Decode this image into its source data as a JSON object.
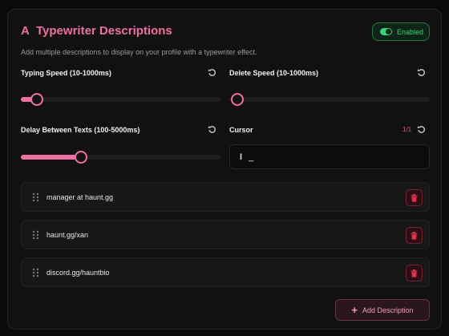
{
  "header": {
    "title": "Typewriter Descriptions",
    "subtitle": "Add multiple descriptions to display on your profile with a typewriter effect.",
    "toggle_label": "Enabled",
    "enabled": true
  },
  "fields": {
    "typing_speed": {
      "label": "Typing Speed (10-1000ms)",
      "level": 0.08
    },
    "delete_speed": {
      "label": "Delete Speed (10-1000ms)",
      "level": 0.0
    },
    "delay_between": {
      "label": "Delay Between Texts (100-5000ms)",
      "level": 0.3
    },
    "cursor": {
      "label": "Cursor",
      "count": "1/1",
      "value": "_"
    }
  },
  "descriptions": [
    {
      "text": "manager at haunt.gg"
    },
    {
      "text": "haunt.gg/xan"
    },
    {
      "text": "discord.gg/hauntbio"
    }
  ],
  "actions": {
    "add_label": "Add Description"
  },
  "colors": {
    "accent": "#f06fa3",
    "enabled": "#34d27a",
    "danger": "#e0304a"
  },
  "icons": {
    "title": "typewriter-a-icon",
    "reset": "reset-icon",
    "drag": "drag-handle-icon",
    "delete": "trash-icon",
    "add": "plus-icon",
    "cursor": "text-cursor-icon"
  }
}
